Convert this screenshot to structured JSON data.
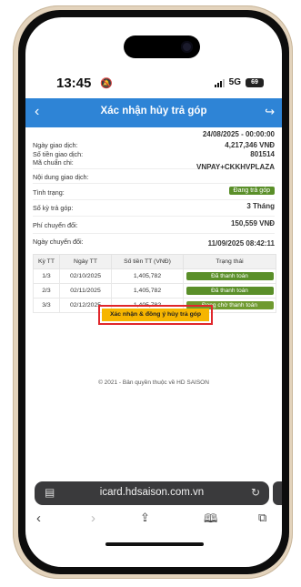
{
  "status_bar": {
    "time": "13:45",
    "network": "5G",
    "battery": "69"
  },
  "header": {
    "title": "Xác nhận hủy trả góp"
  },
  "details": {
    "timestamp": "24/08/2025 - 00:00:00",
    "rows": [
      {
        "label": "Ngày giao dịch:",
        "value": "4,217,346 VNĐ"
      },
      {
        "label": "Số tiền giao dịch:",
        "value": "801514"
      },
      {
        "label": "Mã chuẩn chi:",
        "value": ""
      },
      {
        "label": "Nội dung giao dịch:",
        "value": "VNPAY+CKKHVPLAZA"
      },
      {
        "label": "Tình trạng:",
        "value": "Đang trả góp"
      },
      {
        "label": "Số kỳ trả góp:",
        "value": "3 Tháng"
      },
      {
        "label": "Phí chuyển đổi:",
        "value": "150,559 VNĐ"
      },
      {
        "label": "Ngày chuyển đổi:",
        "value": "11/09/2025 08:42:11"
      }
    ]
  },
  "table": {
    "headers": [
      "Kỳ TT",
      "Ngày TT",
      "Số tiền TT (VNĐ)",
      "Trạng thái"
    ],
    "rows": [
      {
        "period": "1/3",
        "date": "02/10/2025",
        "amount": "1,405,782",
        "status": "Đã thanh toán"
      },
      {
        "period": "2/3",
        "date": "02/11/2025",
        "amount": "1,405,782",
        "status": "Đã thanh toán"
      },
      {
        "period": "3/3",
        "date": "02/12/2025",
        "amount": "1,405,782",
        "status": "Đang chờ thanh toán"
      }
    ]
  },
  "confirm_button": {
    "label": "Xác nhận & đồng ý hủy trả góp"
  },
  "footer": {
    "copyright": "© 2021 - Bản quyền thuộc về HD SAISON"
  },
  "browser": {
    "url": "icard.hdsaison.com.vn"
  },
  "colors": {
    "header_bg": "#2e84d6",
    "status_green": "#5a8f29",
    "confirm_bg": "#f6b500",
    "highlight_border": "#e0262b"
  }
}
